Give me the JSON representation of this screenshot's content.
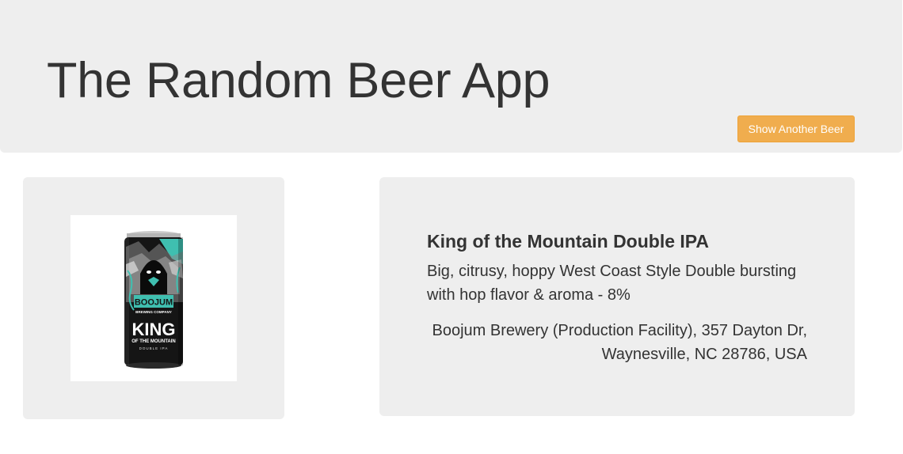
{
  "header": {
    "title": "The Random Beer App",
    "button_label": "Show Another Beer"
  },
  "beer": {
    "name": "King of the Mountain Double IPA",
    "description": "Big, citrusy, hoppy West Coast Style Double bursting with hop flavor & aroma - 8%",
    "brewery_address": "Boojum Brewery (Production Facility), 357 Dayton Dr, Waynesville, NC 28786, USA",
    "can_brand": "BOOJUM",
    "can_subbrand": "BREWING COMPANY",
    "can_title_1": "KING",
    "can_title_2": "OF THE MOUNTAIN",
    "can_style": "DOUBLE IPA"
  },
  "colors": {
    "panel_bg": "#eeeeee",
    "button_bg": "#f0ad4e",
    "text": "#333333",
    "can_teal": "#3fbfb0",
    "can_black": "#151515"
  }
}
